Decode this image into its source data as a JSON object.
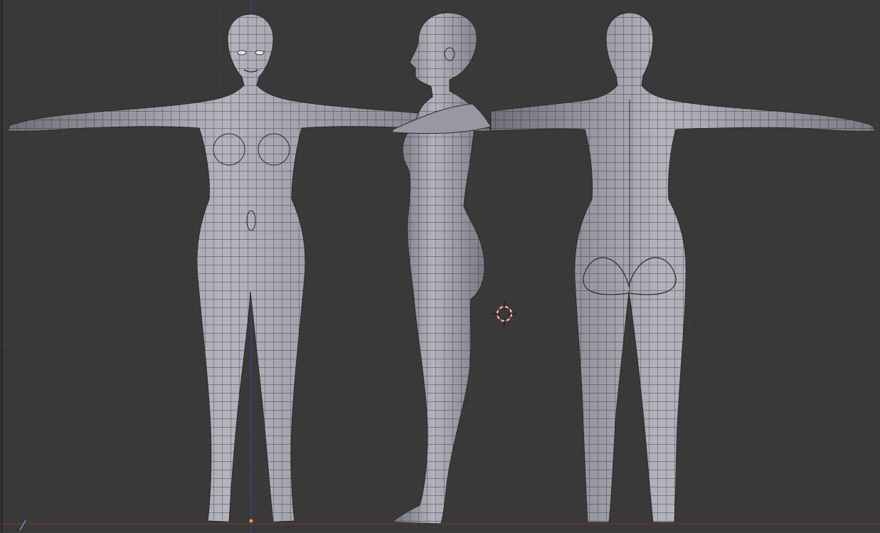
{
  "viewport": {
    "mode": "orthographic",
    "background_color": "#393939",
    "grid_color": "#434343",
    "x_axis_color": "#8c3b3b",
    "y_axis_color": "#3e3ea8",
    "mesh_color": "#9a9aa6",
    "wire_color": "#1a1a1a"
  },
  "scene": {
    "objects": [
      {
        "name": "front-view-figure",
        "view": "front"
      },
      {
        "name": "side-view-figure",
        "view": "side"
      },
      {
        "name": "back-view-figure",
        "view": "back"
      }
    ],
    "cursor_icon": "3d-cursor-icon",
    "origin_icon": "object-origin-icon"
  }
}
